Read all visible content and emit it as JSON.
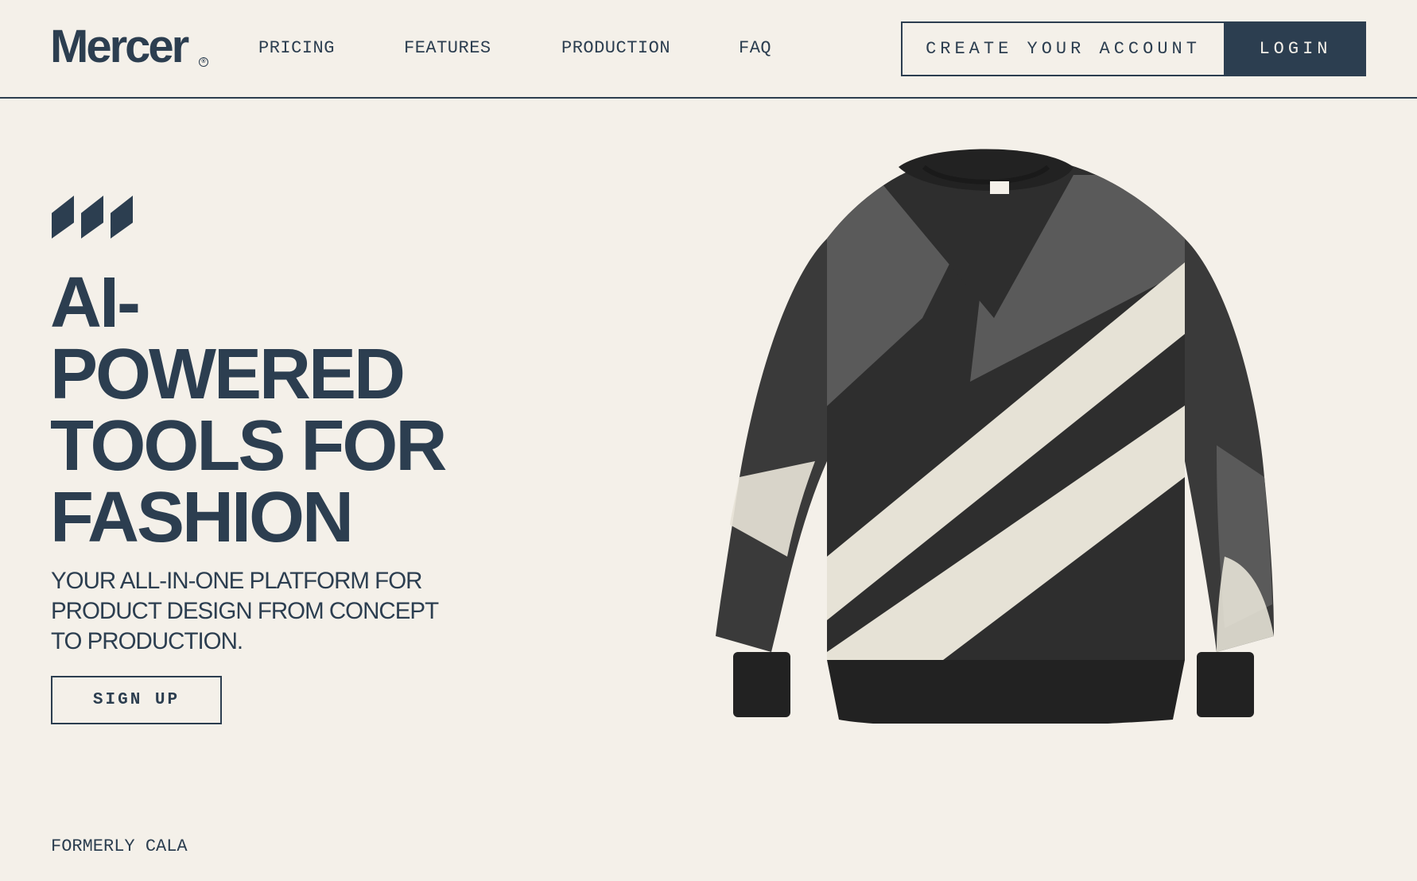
{
  "header": {
    "logo": "Mercer",
    "logo_mark": "®",
    "nav": [
      "PRICING",
      "FEATURES",
      "PRODUCTION",
      "FAQ"
    ],
    "create_account_label": "CREATE YOUR ACCOUNT",
    "login_label": "LOGIN"
  },
  "hero": {
    "title_lines": [
      "AI-",
      "POWERED",
      "TOOLS FOR",
      "FASHION"
    ],
    "subtitle_lines": [
      "YOUR ALL-IN-ONE PLATFORM FOR",
      "PRODUCT DESIGN FROM CONCEPT",
      "TO PRODUCTION."
    ],
    "signup_label": "SIGN UP"
  },
  "footer": {
    "formerly": "FORMERLY CALA"
  },
  "icons": {
    "brand_mark": "slanted-bars-logo-icon",
    "product": "sweatshirt-illustration"
  },
  "colors": {
    "background": "#f4f0e9",
    "primary": "#2c3e50",
    "sweater_dark": "#2e2e2e",
    "sweater_gray": "#5a5a5a",
    "sweater_cream": "#e6e2d6"
  }
}
